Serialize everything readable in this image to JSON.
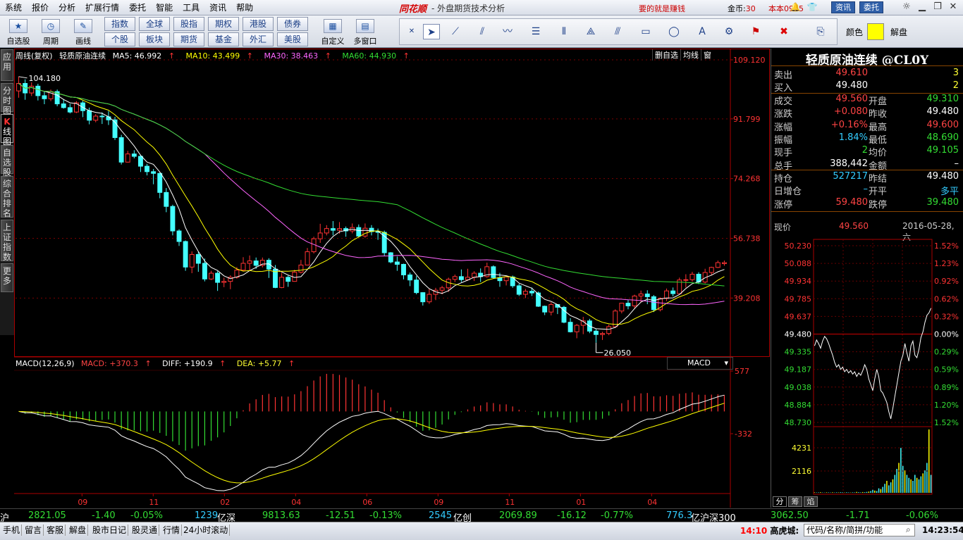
{
  "menu": [
    "系统",
    "报价",
    "分析",
    "扩展行情",
    "委托",
    "智能",
    "工具",
    "资讯",
    "帮助"
  ],
  "brand": "同花顺",
  "window_title": "- 外盘期货技术分析",
  "slogan": "要的就是赚钱",
  "coin_label": "金币:",
  "coin_value": "30",
  "version": "本本0915",
  "news_btn": "资讯",
  "trade_btn": "委托",
  "toolbar": {
    "big": [
      {
        "label": "自选股",
        "icon": "★"
      },
      {
        "label": "周期",
        "icon": "◷"
      },
      {
        "label": "画线",
        "icon": "✎"
      }
    ],
    "markets_row1": [
      "指数",
      "全球",
      "股指",
      "期权",
      "港股",
      "债券"
    ],
    "markets_row2": [
      "个股",
      "板块",
      "期货",
      "基金",
      "外汇",
      "美股"
    ],
    "custom": [
      {
        "label": "自定义",
        "icon": "▦"
      },
      {
        "label": "多窗口",
        "icon": "▤"
      }
    ],
    "color_label": "颜色",
    "color_value": "#ffff00",
    "unlock_label": "解盘"
  },
  "left_tabs": [
    "应用",
    "分时图",
    "K线图",
    "自选股",
    "综合排名",
    "上证指数",
    "更多"
  ],
  "chart_header": {
    "period": "周线(复权)",
    "name": "轻质原油连续",
    "ma5": "MA5: 46.992",
    "ma10": "MA10: 43.499",
    "ma30": "MA30: 38.463",
    "ma60": "MA60: 44.930",
    "arrow": "↑"
  },
  "period_buttons": [
    "删自选",
    "均线",
    "窗"
  ],
  "macd_header": {
    "name": "MACD(12,26,9)",
    "macd": "MACD: +370.3",
    "diff": "DIFF: +190.9",
    "dea": "DEA: +5.77",
    "arrow": "↑"
  },
  "macd_selector": "MACD",
  "chart_data": [
    {
      "type": "candlestick",
      "title": "轻质原油连续",
      "y_ticks": [
        "109.120",
        "91.799",
        "74.268",
        "56.738",
        "39.208"
      ],
      "x_ticks": [
        "09",
        "11",
        "02",
        "04",
        "06",
        "09",
        "11",
        "01",
        "04"
      ],
      "high_label": "104.180",
      "low_label": "26.050",
      "ylim": [
        26.05,
        109.12
      ],
      "candles": [
        [
          100,
          102.2,
          98,
          104.2
        ],
        [
          102.2,
          99.4,
          97.4,
          103.4
        ],
        [
          99.4,
          101.4,
          98.5,
          102.5
        ],
        [
          101.4,
          98.6,
          97.2,
          102.1
        ],
        [
          98.6,
          97.7,
          96.1,
          99.9
        ],
        [
          97.7,
          99.8,
          97,
          100.4
        ],
        [
          99.8,
          96.2,
          95.5,
          100.4
        ],
        [
          96.2,
          95.1,
          94.8,
          97.6
        ],
        [
          95.1,
          93.8,
          93.4,
          96.2
        ],
        [
          93.8,
          96.5,
          93.5,
          97
        ],
        [
          96.5,
          94.2,
          92.3,
          97.1
        ],
        [
          94.2,
          91.4,
          90.2,
          95.1
        ],
        [
          91.4,
          92.6,
          90.8,
          93.2
        ],
        [
          92.6,
          92.4,
          90.3,
          93.7
        ],
        [
          92.4,
          91.5,
          90,
          94.1
        ],
        [
          91.5,
          86.3,
          85.6,
          92.4
        ],
        [
          86.3,
          79.1,
          78.4,
          87.1
        ],
        [
          79.1,
          81.5,
          79,
          82.4
        ],
        [
          81.5,
          80.8,
          80.2,
          82.6
        ],
        [
          80.8,
          77.9,
          76.2,
          81.3
        ],
        [
          77.9,
          76.3,
          75.2,
          78.6
        ],
        [
          76.3,
          75.8,
          72.6,
          77.1
        ],
        [
          75.8,
          70.2,
          68.5,
          76
        ],
        [
          70.2,
          66.1,
          64.4,
          71.5
        ],
        [
          66.1,
          58.9,
          57.6,
          66.6
        ],
        [
          58.9,
          55.8,
          54.5,
          59.4
        ],
        [
          55.8,
          48.3,
          47.2,
          56.1
        ],
        [
          48.3,
          52,
          46.5,
          52.9
        ],
        [
          52,
          49.4,
          46.9,
          52.7
        ],
        [
          49.4,
          44.8,
          44.1,
          50.8
        ],
        [
          44.8,
          46.5,
          44.5,
          47.2
        ],
        [
          46.5,
          43.8,
          41.3,
          47.1
        ],
        [
          43.8,
          44.1,
          42.4,
          45.2
        ],
        [
          44.1,
          45.3,
          41.8,
          45.9
        ],
        [
          45.3,
          47.4,
          44.9,
          48.3
        ],
        [
          47.4,
          49.4,
          47.1,
          51.2
        ],
        [
          49.4,
          50.1,
          47.3,
          51.7
        ],
        [
          50.1,
          48.8,
          47.8,
          51.1
        ],
        [
          48.8,
          50.3,
          48.2,
          51.1
        ],
        [
          50.3,
          47.7,
          45.1,
          50.9
        ],
        [
          47.7,
          42.3,
          42.1,
          48.9
        ],
        [
          42.3,
          45.3,
          42.1,
          46.6
        ],
        [
          45.3,
          44.1,
          42.5,
          45.8
        ],
        [
          44.1,
          46.8,
          44,
          47.5
        ],
        [
          46.8,
          48.9,
          46.4,
          50.4
        ],
        [
          48.9,
          52.8,
          48.8,
          53.9
        ],
        [
          52.8,
          56.6,
          52.3,
          57.2
        ],
        [
          56.6,
          58.3,
          55.4,
          61
        ],
        [
          58.3,
          59.6,
          57.6,
          60.6
        ],
        [
          59.6,
          59.1,
          57.6,
          61.8
        ],
        [
          59.1,
          59.6,
          58.1,
          61.5
        ],
        [
          59.6,
          58.9,
          57.2,
          60.2
        ],
        [
          58.9,
          59.9,
          58.2,
          61.1
        ],
        [
          59.9,
          57.4,
          57,
          60.8
        ],
        [
          57.4,
          59.7,
          56.9,
          61.1
        ],
        [
          59.7,
          58.7,
          57.6,
          60.6
        ],
        [
          58.7,
          58.5,
          56.3,
          59.6
        ],
        [
          58.5,
          52.5,
          51.6,
          59
        ],
        [
          52.5,
          49.8,
          49.4,
          52.7
        ],
        [
          49.8,
          49.1,
          47.2,
          51.4
        ],
        [
          49.1,
          46,
          44.7,
          49.3
        ],
        [
          46,
          44.5,
          42.7,
          46.7
        ],
        [
          44.5,
          40.8,
          40.3,
          45.7
        ],
        [
          40.8,
          38.1,
          37,
          40.9
        ],
        [
          38.1,
          40.3,
          37.5,
          41.9
        ],
        [
          40.3,
          41.5,
          38.6,
          42.2
        ],
        [
          41.5,
          42.2,
          40.3,
          42.8
        ],
        [
          42.2,
          44.7,
          41,
          45.2
        ],
        [
          44.7,
          45.5,
          43.9,
          46.1
        ],
        [
          45.5,
          44.6,
          43.9,
          47.6
        ],
        [
          44.6,
          45.3,
          44.3,
          47.8
        ],
        [
          45.3,
          46.5,
          44.2,
          47.1
        ],
        [
          46.5,
          45.5,
          43.9,
          47.9
        ],
        [
          45.5,
          48.4,
          45.2,
          49.6
        ],
        [
          48.4,
          45.2,
          44.9,
          48.8
        ],
        [
          45.2,
          44.3,
          42.5,
          46.6
        ],
        [
          44.3,
          45.4,
          42.9,
          45.5
        ],
        [
          45.4,
          42.8,
          42.2,
          45.8
        ],
        [
          42.8,
          40.3,
          39.8,
          43.4
        ],
        [
          40.3,
          41.2,
          39.2,
          41.9
        ],
        [
          41.2,
          40.7,
          39.8,
          42.3
        ],
        [
          40.7,
          36.8,
          36.6,
          41.1
        ],
        [
          36.8,
          35.1,
          34.2,
          37
        ],
        [
          35.1,
          37.3,
          34.1,
          38
        ],
        [
          37.3,
          36.5,
          34.5,
          37.3
        ],
        [
          36.5,
          32.1,
          31.8,
          36.9
        ],
        [
          32.1,
          29.3,
          29.1,
          33.3
        ],
        [
          29.3,
          31.2,
          27.4,
          31.6
        ],
        [
          31.2,
          32.5,
          28.6,
          33.7
        ],
        [
          32.5,
          29.5,
          28.9,
          33.1
        ],
        [
          29.5,
          28.5,
          26.1,
          30.1
        ],
        [
          28.5,
          28.8,
          26.9,
          29.3
        ],
        [
          28.8,
          30.8,
          28.3,
          31.4
        ],
        [
          30.8,
          35.4,
          30.4,
          35.9
        ],
        [
          35.4,
          37.7,
          34.7,
          37.8
        ],
        [
          37.7,
          36.9,
          35.9,
          38.6
        ],
        [
          36.9,
          39.8,
          36.2,
          40.2
        ],
        [
          39.8,
          40.4,
          37.9,
          41.4
        ],
        [
          40.4,
          39.6,
          37.4,
          41.5
        ],
        [
          39.6,
          35.8,
          35.1,
          40.1
        ],
        [
          35.8,
          39.1,
          35.3,
          39.4
        ],
        [
          39.1,
          41.3,
          38.3,
          42
        ],
        [
          41.3,
          40.5,
          39.7,
          42.3
        ],
        [
          40.5,
          44.5,
          40.5,
          45.2
        ],
        [
          44.5,
          44.6,
          42.3,
          46.2
        ],
        [
          44.6,
          46.2,
          44,
          46.9
        ],
        [
          46.2,
          43.9,
          43.3,
          46.8
        ],
        [
          43.9,
          46.7,
          43.5,
          47.8
        ],
        [
          46.7,
          48.2,
          45.9,
          48.4
        ],
        [
          48.2,
          49.6,
          48,
          50.2
        ],
        [
          49.3,
          49.6,
          48.7,
          50.2
        ]
      ],
      "series": [
        {
          "name": "MA5",
          "color": "#ffffff"
        },
        {
          "name": "MA10",
          "color": "#ffff00"
        },
        {
          "name": "MA30",
          "color": "#ff66ff"
        },
        {
          "name": "MA60",
          "color": "#33dd33"
        }
      ]
    },
    {
      "type": "bar",
      "title": "MACD(12,26,9)",
      "y_ticks": [
        "577",
        "-332"
      ],
      "diff_color": "#ffffff",
      "dea_color": "#ffff00"
    },
    {
      "type": "line",
      "title": "分时",
      "y_ticks_left": [
        "50.230",
        "50.088",
        "49.934",
        "49.785",
        "49.637",
        "49.480",
        "49.335",
        "49.187",
        "49.038",
        "48.884",
        "48.730"
      ],
      "y_ticks_right": [
        "1.52%",
        "1.23%",
        "0.92%",
        "0.62%",
        "0.32%",
        "0.00%",
        "0.29%",
        "0.59%",
        "0.89%",
        "1.20%",
        "1.52%"
      ],
      "vol_ticks": [
        "4231",
        "2116"
      ],
      "ylim": [
        48.73,
        50.23
      ],
      "prev_close": 49.48,
      "prices": [
        49.38,
        49.43,
        49.4,
        49.36,
        49.42,
        49.46,
        49.44,
        49.4,
        49.35,
        49.3,
        49.24,
        49.2,
        49.22,
        49.18,
        49.2,
        49.16,
        49.18,
        49.15,
        49.17,
        49.14,
        49.16,
        49.12,
        49.15,
        49.13,
        49.17,
        49.22,
        49.18,
        49.1,
        49.05,
        49.0,
        49.1,
        49.18,
        49.12,
        49.0,
        48.98,
        48.94,
        48.9,
        48.82,
        48.76,
        48.85,
        48.95,
        49.05,
        49.15,
        49.25,
        49.3,
        49.4,
        49.32,
        49.25,
        49.38,
        49.42,
        49.3,
        49.28,
        49.35,
        49.45,
        49.5,
        49.58,
        49.64,
        49.66,
        49.7
      ],
      "volumes": [
        30,
        20,
        25,
        40,
        20,
        15,
        30,
        25,
        20,
        35,
        20,
        30,
        25,
        40,
        30,
        20,
        35,
        25,
        20,
        30,
        25,
        60,
        40,
        30,
        50,
        40,
        60,
        80,
        120,
        200,
        150,
        120,
        300,
        250,
        400,
        600,
        800,
        500,
        700,
        900,
        1200,
        1600,
        2000,
        3000,
        1800,
        1500,
        1200,
        1000,
        900,
        800,
        1200,
        1000,
        900,
        1100,
        1300,
        1500,
        2000,
        4231,
        1200
      ]
    }
  ],
  "quote": {
    "title": "轻质原油连续 @CL0Y",
    "ask_label": "卖出",
    "ask": "49.610",
    "ask_vol": "3",
    "bid_label": "买入",
    "bid": "49.480",
    "bid_vol": "2",
    "rows": [
      {
        "l": "成交",
        "v": "49.560",
        "vc": "red",
        "l2": "开盘",
        "v2": "49.310",
        "v2c": "green"
      },
      {
        "l": "涨跌",
        "v": "+0.080",
        "vc": "red",
        "l2": "昨收",
        "v2": "49.480",
        "v2c": "white"
      },
      {
        "l": "涨幅",
        "v": "+0.16%",
        "vc": "red",
        "l2": "最高",
        "v2": "49.600",
        "v2c": "red"
      },
      {
        "l": "振幅",
        "v": "1.84%",
        "vc": "cyan",
        "l2": "最低",
        "v2": "48.690",
        "v2c": "green"
      },
      {
        "l": "现手",
        "v": "2",
        "vc": "green",
        "l2": "均价",
        "v2": "49.105",
        "v2c": "green"
      },
      {
        "l": "总手",
        "v": "388,442",
        "vc": "white",
        "l2": "金额",
        "v2": "–",
        "v2c": "white"
      }
    ],
    "rows2": [
      {
        "l": "持仓",
        "v": "527217",
        "vc": "cyan",
        "l2": "昨结",
        "v2": "49.480",
        "v2c": "white"
      },
      {
        "l": "日增仓",
        "v": "–",
        "vc": "cyan",
        "l2": "开平",
        "v2": "多平",
        "v2c": "cyan"
      },
      {
        "l": "涨停",
        "v": "59.480",
        "vc": "red",
        "l2": "跌停",
        "v2": "39.480",
        "v2c": "green"
      }
    ],
    "now_label": "现价",
    "now_price": "49.560",
    "now_date": "2016-05-28,六"
  },
  "min_tabs": [
    "分",
    "筹",
    "焰"
  ],
  "index_bar": [
    {
      "t": "沪",
      "c": "#ffffff"
    },
    {
      "t": "2821.05",
      "c": "#33dd33"
    },
    {
      "t": "-1.40",
      "c": "#33dd33"
    },
    {
      "t": "-0.05%",
      "c": "#33dd33"
    },
    {
      "t": "1239",
      "c": "#33ccff"
    },
    {
      "t": "亿深",
      "c": "#ffffff"
    },
    {
      "t": "9813.63",
      "c": "#33dd33"
    },
    {
      "t": "-12.51",
      "c": "#33dd33"
    },
    {
      "t": "-0.13%",
      "c": "#33dd33"
    },
    {
      "t": "2545",
      "c": "#33ccff"
    },
    {
      "t": "亿创",
      "c": "#ffffff"
    },
    {
      "t": "2069.89",
      "c": "#33dd33"
    },
    {
      "t": "-16.12",
      "c": "#33dd33"
    },
    {
      "t": "-0.77%",
      "c": "#33dd33"
    },
    {
      "t": "776.3",
      "c": "#33ccff"
    },
    {
      "t": "亿沪深300",
      "c": "#ffffff"
    },
    {
      "t": "3062.50",
      "c": "#33dd33"
    },
    {
      "t": "-1.71",
      "c": "#33dd33"
    },
    {
      "t": "-0.06%",
      "c": "#33dd33"
    }
  ],
  "status_bar": [
    "手机",
    "留言",
    "客服",
    "解盘",
    "股市日记",
    "股灵通",
    "行情",
    "24小时滚动"
  ],
  "ticker_time": "14:10",
  "ticker_text": "高虎城:",
  "search_placeholder": "代码/名称/简拼/功能",
  "clock": "14:23:54"
}
